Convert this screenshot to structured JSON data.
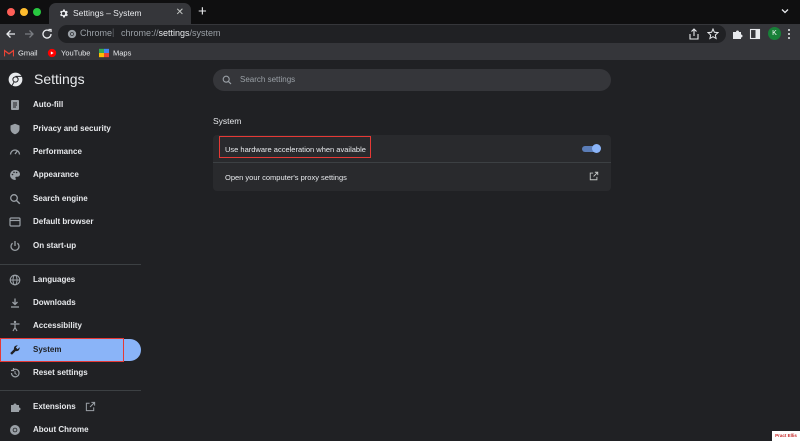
{
  "browser": {
    "tab_title": "Settings – System",
    "new_tab_label": "+",
    "tab_close_label": "✕",
    "omnibox_scheme": "Chrome",
    "omnibox_separator": "|",
    "omnibox_url_prefix": "chrome://",
    "omnibox_url_host": "settings",
    "omnibox_url_path": "/system",
    "profile_initial": "K"
  },
  "bookmarks": [
    {
      "label": "Gmail",
      "icon": "gmail-icon"
    },
    {
      "label": "YouTube",
      "icon": "youtube-icon"
    },
    {
      "label": "Maps",
      "icon": "maps-icon"
    }
  ],
  "settings": {
    "title": "Settings",
    "search_placeholder": "Search settings",
    "nav": [
      {
        "label": "Auto-fill",
        "icon": "autofill-icon"
      },
      {
        "label": "Privacy and security",
        "icon": "shield-icon"
      },
      {
        "label": "Performance",
        "icon": "speedometer-icon"
      },
      {
        "label": "Appearance",
        "icon": "palette-icon"
      },
      {
        "label": "Search engine",
        "icon": "search-icon"
      },
      {
        "label": "Default browser",
        "icon": "browser-icon"
      },
      {
        "label": "On start-up",
        "icon": "power-icon"
      },
      {
        "label": "Languages",
        "icon": "globe-icon"
      },
      {
        "label": "Downloads",
        "icon": "download-icon"
      },
      {
        "label": "Accessibility",
        "icon": "accessibility-icon"
      },
      {
        "label": "System",
        "icon": "wrench-icon",
        "active": true
      },
      {
        "label": "Reset settings",
        "icon": "reset-icon"
      },
      {
        "label": "Extensions",
        "icon": "puzzle-icon"
      },
      {
        "label": "About Chrome",
        "icon": "chrome-icon"
      }
    ],
    "section_title": "System",
    "rows": [
      {
        "label": "Use hardware acceleration when available",
        "control": "toggle",
        "checked": true
      },
      {
        "label": "Open your computer's proxy settings",
        "control": "external-link-icon"
      }
    ]
  },
  "watermark_text": "Pract Ellis",
  "colors": {
    "accent": "#8ab4f8",
    "highlight": "#e53935",
    "background": "#202124"
  }
}
